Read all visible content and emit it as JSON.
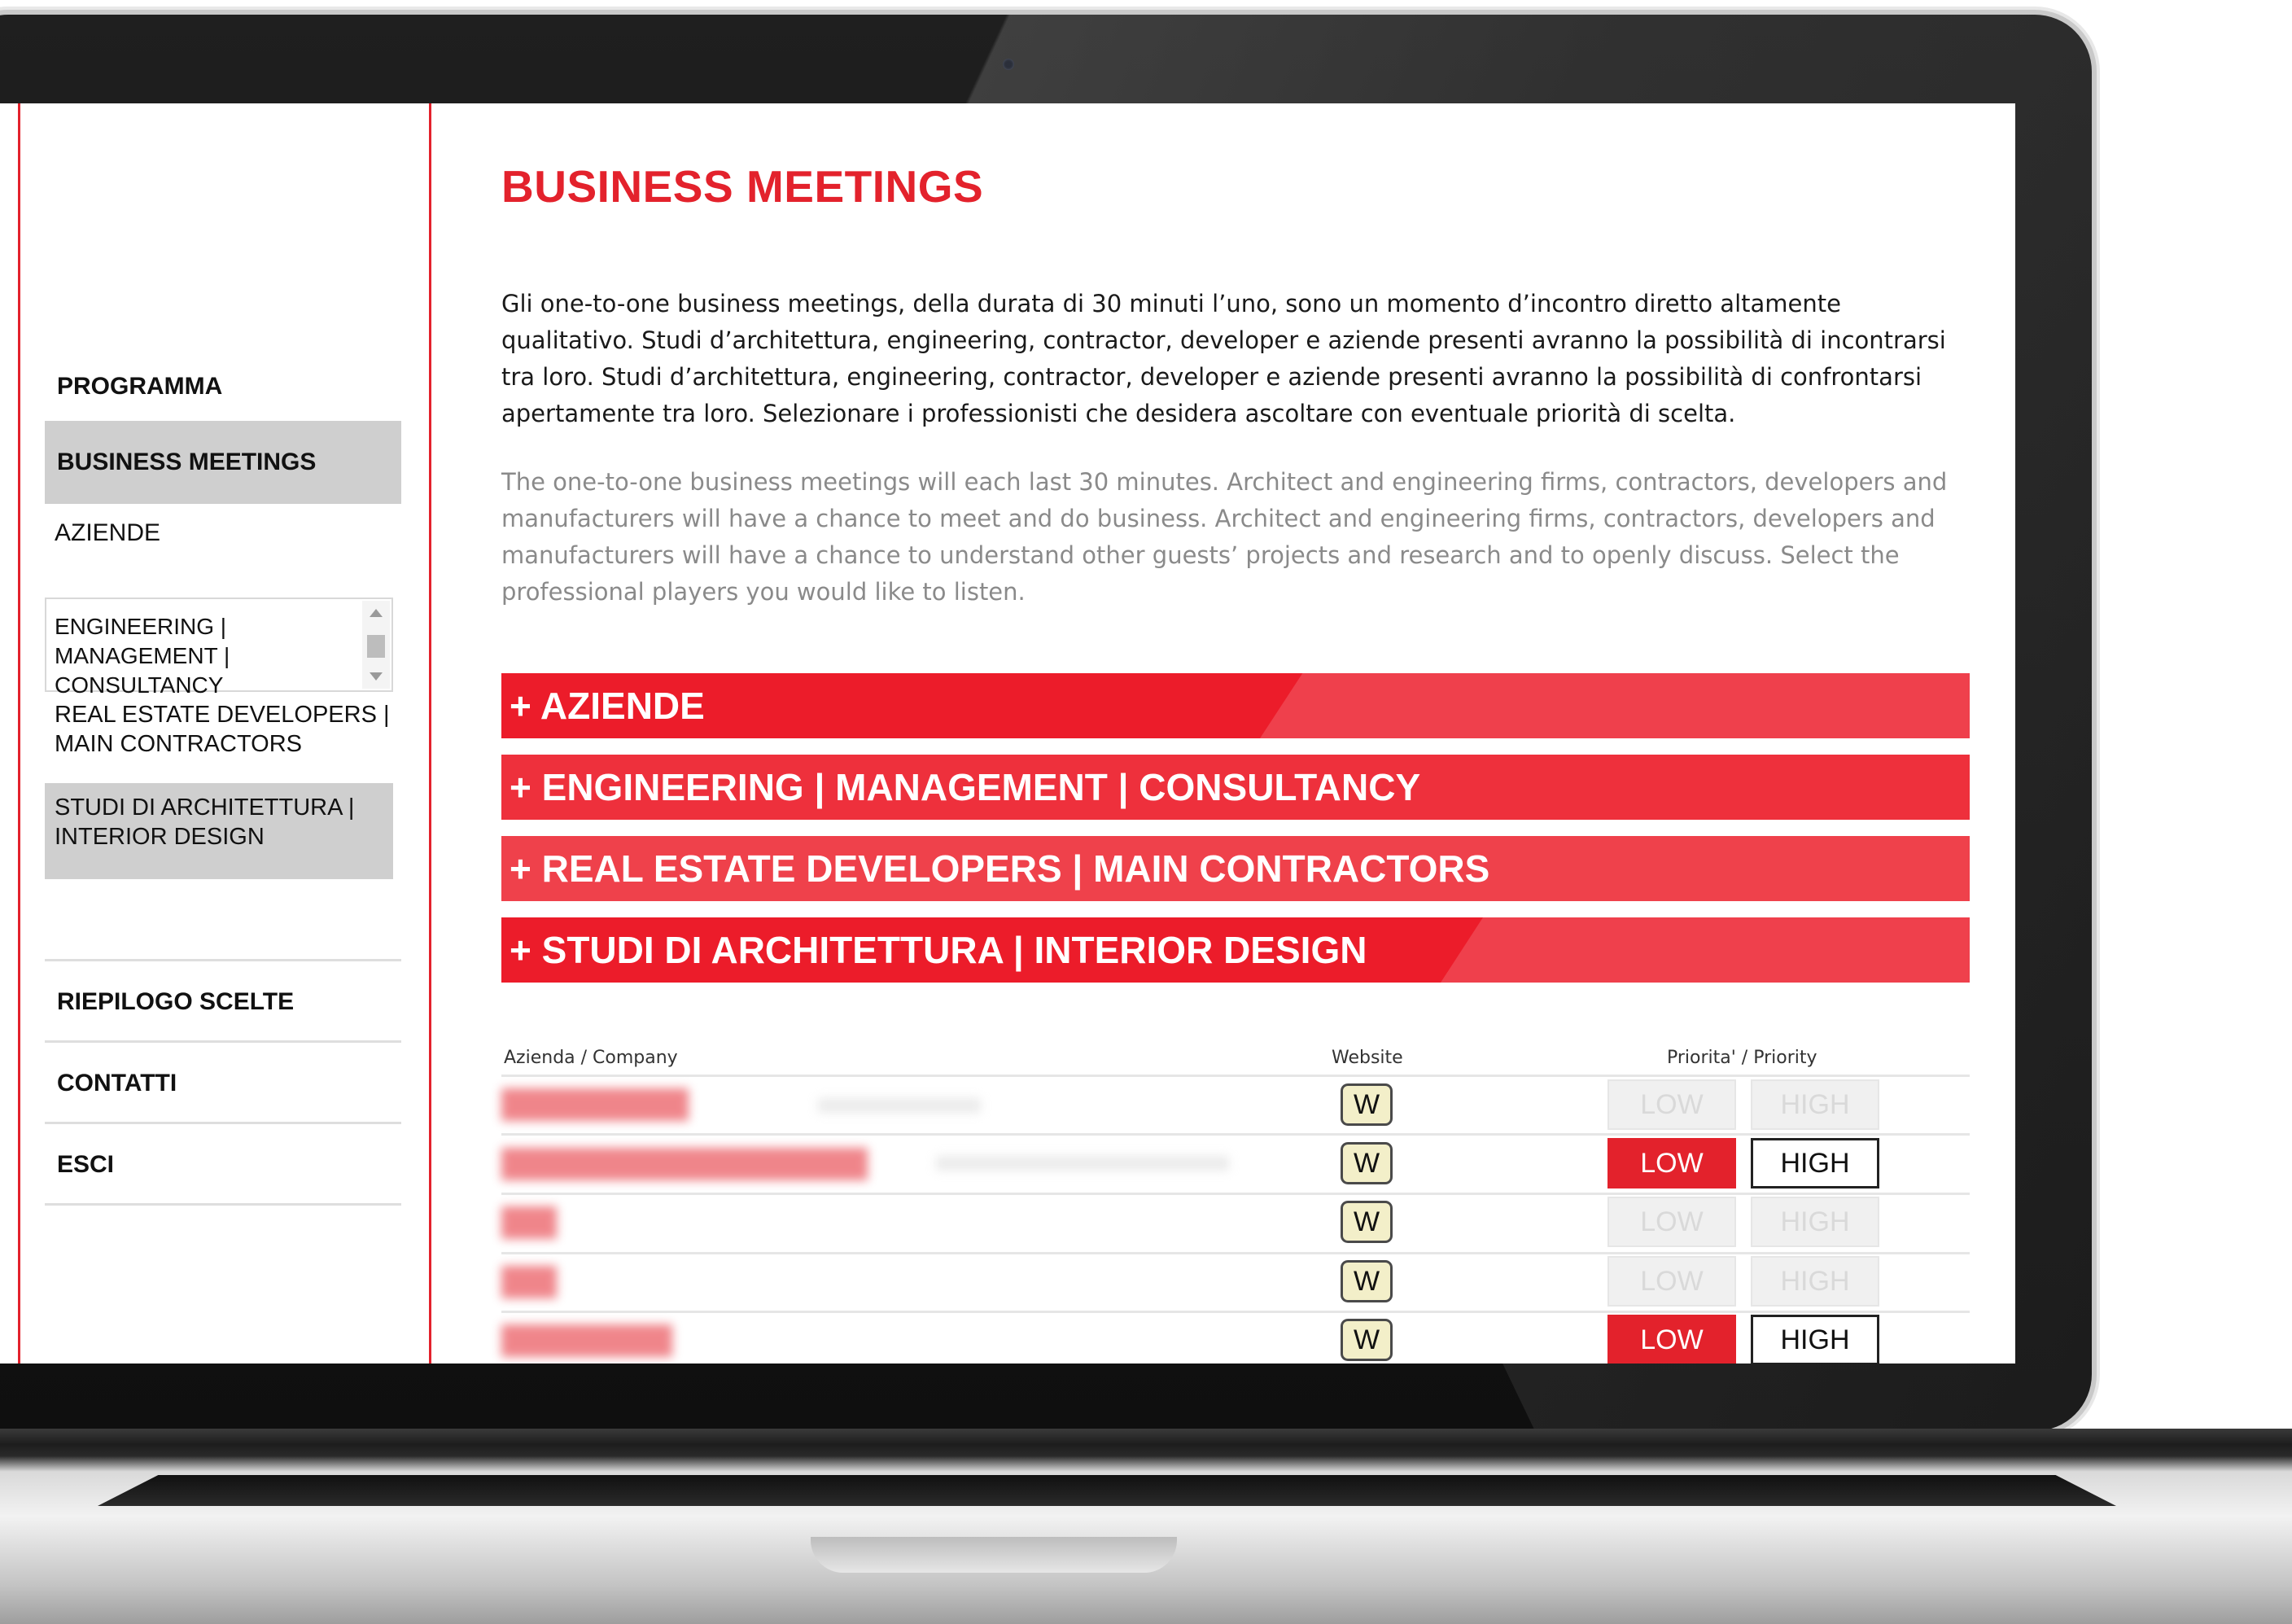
{
  "sidebar": {
    "programma": "PROGRAMMA",
    "business_meetings": "BUSINESS MEETINGS",
    "aziende": "AZIENDE",
    "sub_list_item_1": "ENGINEERING | MANAGEMENT | CONSULTANCY",
    "sub_list_item_2": "REAL ESTATE DEVELOPERS | MAIN CONTRACTORS",
    "sub_list_item_3": "STUDI DI ARCHITETTURA | INTERIOR DESIGN",
    "riepilogo": "RIEPILOGO SCELTE",
    "contatti": "CONTATTI",
    "esci": "ESCI"
  },
  "main": {
    "title": "BUSINESS MEETINGS",
    "intro_it": "Gli one-to-one business meetings, della durata di 30 minuti l’uno, sono un momento d’incontro diretto altamente qualitativo. Studi d’architettura, engineering, contractor, developer e aziende presenti avranno la possibilità di incontrarsi tra loro. Studi d’architettura, engineering, contractor, developer e aziende presenti avranno la possibilità di confrontarsi apertamente tra loro. Selezionare i professionisti che desidera ascoltare con eventuale priorità di scelta.",
    "intro_en": "The one-to-one business meetings will each last 30 minutes. Architect and engineering firms, contractors, developers and manufacturers will have a chance to meet and do business. Architect and engineering firms, contractors, developers and manufacturers will have a chance to understand other guests’ projects and research and to openly discuss. Select the professional players you would like to listen.",
    "accordions": [
      {
        "label": "+ AZIENDE",
        "color": "#ec1c2a"
      },
      {
        "label": "+ ENGINEERING | MANAGEMENT | CONSULTANCY",
        "color": "#ed2430"
      },
      {
        "label": "+ REAL ESTATE DEVELOPERS | MAIN CONTRACTORS",
        "color": "#ee2c37"
      },
      {
        "label": "+ STUDI DI ARCHITETTURA | INTERIOR DESIGN",
        "color": "#ec1c2a"
      }
    ]
  },
  "table": {
    "col_company": "Azienda / Company",
    "col_website": "Website",
    "col_priority": "Priorita' / Priority",
    "website_label": "W",
    "low_label": "LOW",
    "high_label": "HIGH",
    "rows": [
      {
        "selected": false
      },
      {
        "selected": true
      },
      {
        "selected": false
      },
      {
        "selected": false
      },
      {
        "selected": true
      }
    ]
  },
  "colors": {
    "accent": "#e3222c",
    "active_nav": "#cfcfcf"
  }
}
